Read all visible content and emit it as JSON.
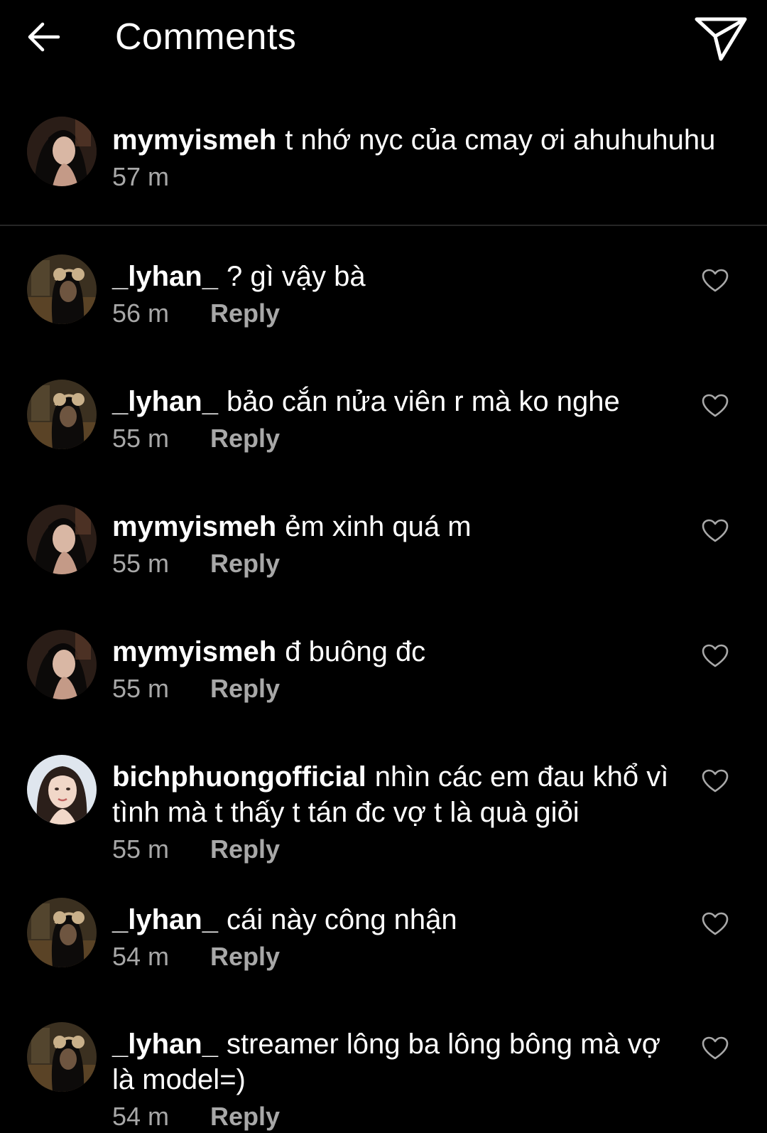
{
  "header": {
    "title": "Comments",
    "back_icon": "arrow-left-icon",
    "send_icon": "paper-plane-icon"
  },
  "caption": {
    "username": "mymyismeh",
    "text": "t nhớ nyc của cmay ơi ahuhuhuhu",
    "time": "57 m"
  },
  "reply_label": "Reply",
  "comments": [
    {
      "username": "_lyhan_",
      "text": "? gì vậy bà",
      "time": "56 m"
    },
    {
      "username": "_lyhan_",
      "text": "bảo cắn nửa viên r mà ko nghe",
      "time": "55 m"
    },
    {
      "username": "mymyismeh",
      "text": "ẻm xinh quá m",
      "time": "55 m"
    },
    {
      "username": "mymyismeh",
      "text": "đ buông đc",
      "time": "55 m"
    },
    {
      "username": "bichphuongofficial",
      "text": "nhìn các em đau khổ vì tình mà t thấy t tán đc vợ t là quà giỏi",
      "time": "55 m"
    },
    {
      "username": "_lyhan_",
      "text": "cái này công nhận",
      "time": "54 m"
    },
    {
      "username": "_lyhan_",
      "text": "streamer lông ba lông bông mà vợ là model=)",
      "time": "54 m"
    }
  ],
  "colors": {
    "background": "#000000",
    "text": "#ffffff",
    "secondary": "#a8a8a8",
    "divider": "#262626"
  }
}
